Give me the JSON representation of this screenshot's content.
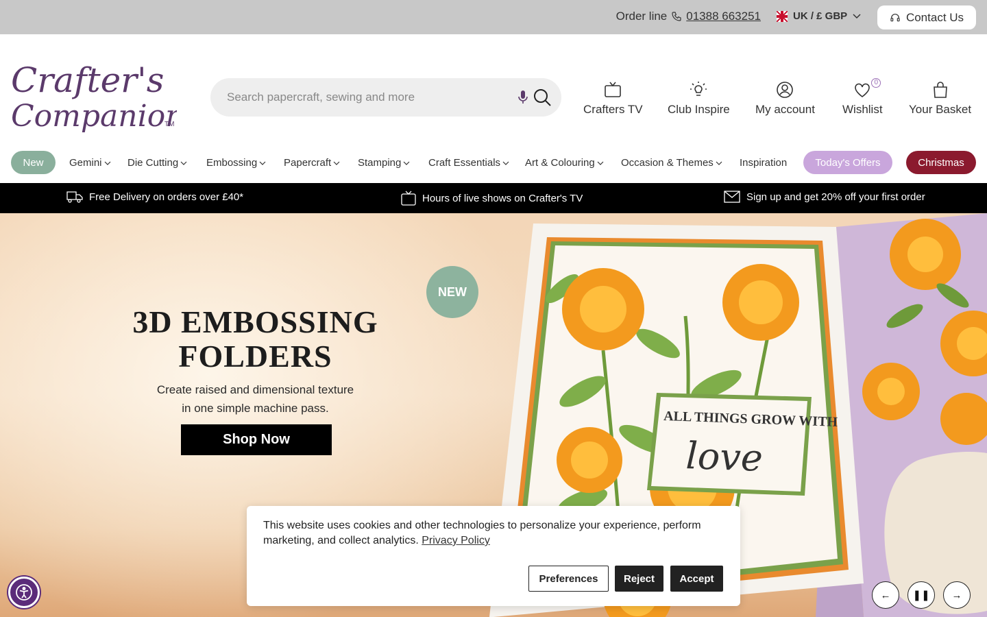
{
  "topbar": {
    "order_label": "Order line",
    "phone": "01388 663251",
    "locale": "UK / £ GBP",
    "contact_label": "Contact Us"
  },
  "brand": {
    "logo_line1": "Crafter's",
    "logo_line2": "Companion",
    "logo_tm": "TM",
    "color": "#5b3a6b"
  },
  "search": {
    "placeholder": "Search papercraft, sewing and more"
  },
  "header_nav": [
    {
      "label": "Crafters TV",
      "icon": "tv-icon"
    },
    {
      "label": "Club Inspire",
      "icon": "lightbulb-icon"
    },
    {
      "label": "My account",
      "icon": "user-icon"
    },
    {
      "label": "Wishlist",
      "icon": "heart-icon",
      "count": "0"
    },
    {
      "label": "Your Basket",
      "icon": "bag-icon"
    }
  ],
  "categories": {
    "new_label": "New",
    "items": [
      "Gemini",
      "Die Cutting",
      "Embossing",
      "Papercraft",
      "Stamping",
      "Craft Essentials",
      "Art & Colouring",
      "Occasion & Themes"
    ],
    "inspiration_label": "Inspiration",
    "offers_label": "Today's Offers",
    "christmas_label": "Christmas"
  },
  "strip": {
    "delivery": "Free Delivery on orders over £40*",
    "shows": "Hours of live shows on Crafter's TV",
    "signup": "Sign up and get 20% off your first order"
  },
  "hero": {
    "title_line1": "3D EMBOSSING",
    "title_line2": "FOLDERS",
    "subtitle_line1": "Create raised and dimensional texture",
    "subtitle_line2": "in one simple machine pass.",
    "cta": "Shop Now",
    "badge": "NEW",
    "card_text_line1": "ALL THINGS GROW WITH",
    "card_text_line2": "love"
  },
  "cookie": {
    "text": "This website uses cookies and other technologies to personalize your experience, perform marketing, and collect analytics.",
    "policy_link": "Privacy Policy",
    "preferences": "Preferences",
    "reject": "Reject",
    "accept": "Accept"
  },
  "carousel": {
    "prev": "←",
    "pause": "❚❚",
    "next": "→"
  },
  "colors": {
    "new_pill": "#8aaf9c",
    "offers_pill": "#c9a6dc",
    "christmas_pill": "#8b1a2e",
    "strip_bg": "#000000",
    "a11y": "#5b2c7a"
  }
}
